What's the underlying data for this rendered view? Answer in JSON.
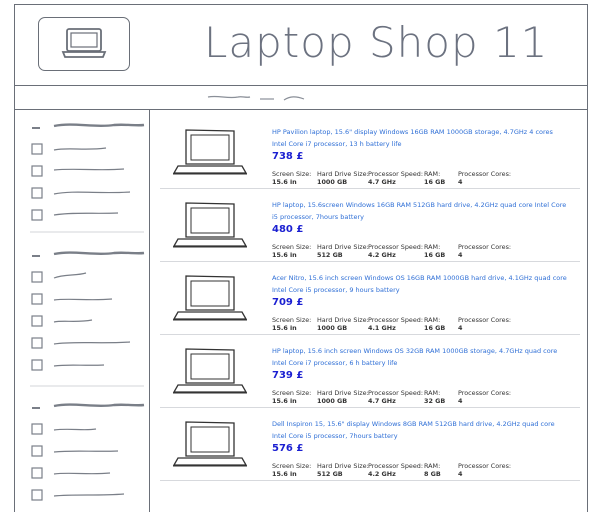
{
  "header": {
    "title": "Laptop Shop 11",
    "logo_icon": "laptop-icon"
  },
  "products": [
    {
      "description": "HP Pavilion laptop, 15.6\" display Windows 16GB RAM 1000GB storage, 4.7GHz 4 cores Intel Core i7 processor, 13 h battery life",
      "price": "738 £",
      "specs": [
        {
          "label": "Screen Size:",
          "value": "15.6 in"
        },
        {
          "label": "Hard Drive Size:",
          "value": "1000 GB"
        },
        {
          "label": "Processor Speed:",
          "value": "4.7 GHz"
        },
        {
          "label": "RAM:",
          "value": "16 GB"
        },
        {
          "label": "Processor Cores:",
          "value": "4"
        }
      ]
    },
    {
      "description": "HP laptop, 15.6screen Windows 16GB RAM 512GB hard drive, 4.2GHz quad core Intel Core i5 processor, 7hours battery",
      "price": "480 £",
      "specs": [
        {
          "label": "Screen Size:",
          "value": "15.6 in"
        },
        {
          "label": "Hard Drive Size:",
          "value": "512 GB"
        },
        {
          "label": "Processor Speed:",
          "value": "4.2 GHz"
        },
        {
          "label": "RAM:",
          "value": "16 GB"
        },
        {
          "label": "Processor Cores:",
          "value": "4"
        }
      ]
    },
    {
      "description": "Acer Nitro, 15.6 inch screen Windows OS 16GB RAM 1000GB hard drive, 4.1GHz quad core Intel Core i5 processor, 9 hours battery",
      "price": "709 £",
      "specs": [
        {
          "label": "Screen Size:",
          "value": "15.6 in"
        },
        {
          "label": "Hard Drive Size:",
          "value": "1000 GB"
        },
        {
          "label": "Processor Speed:",
          "value": "4.1 GHz"
        },
        {
          "label": "RAM:",
          "value": "16 GB"
        },
        {
          "label": "Processor Cores:",
          "value": "4"
        }
      ]
    },
    {
      "description": "HP laptop, 15.6 inch screen Windows OS 32GB RAM 1000GB storage, 4.7GHz quad core Intel Core i7 processor, 6 h battery life",
      "price": "739 £",
      "specs": [
        {
          "label": "Screen Size:",
          "value": "15.6 in"
        },
        {
          "label": "Hard Drive Size:",
          "value": "1000 GB"
        },
        {
          "label": "Processor Speed:",
          "value": "4.7 GHz"
        },
        {
          "label": "RAM:",
          "value": "32 GB"
        },
        {
          "label": "Processor Cores:",
          "value": "4"
        }
      ]
    },
    {
      "description": "Dell Inspiron 15, 15.6\" display Windows 8GB RAM 512GB hard drive, 4.2GHz quad core Intel Core i5 processor, 7hours battery",
      "price": "576 £",
      "specs": [
        {
          "label": "Screen Size:",
          "value": "15.6 in"
        },
        {
          "label": "Hard Drive Size:",
          "value": "512 GB"
        },
        {
          "label": "Processor Speed:",
          "value": "4.2 GHz"
        },
        {
          "label": "RAM:",
          "value": "8 GB"
        },
        {
          "label": "Processor Cores:",
          "value": "4"
        }
      ]
    }
  ]
}
